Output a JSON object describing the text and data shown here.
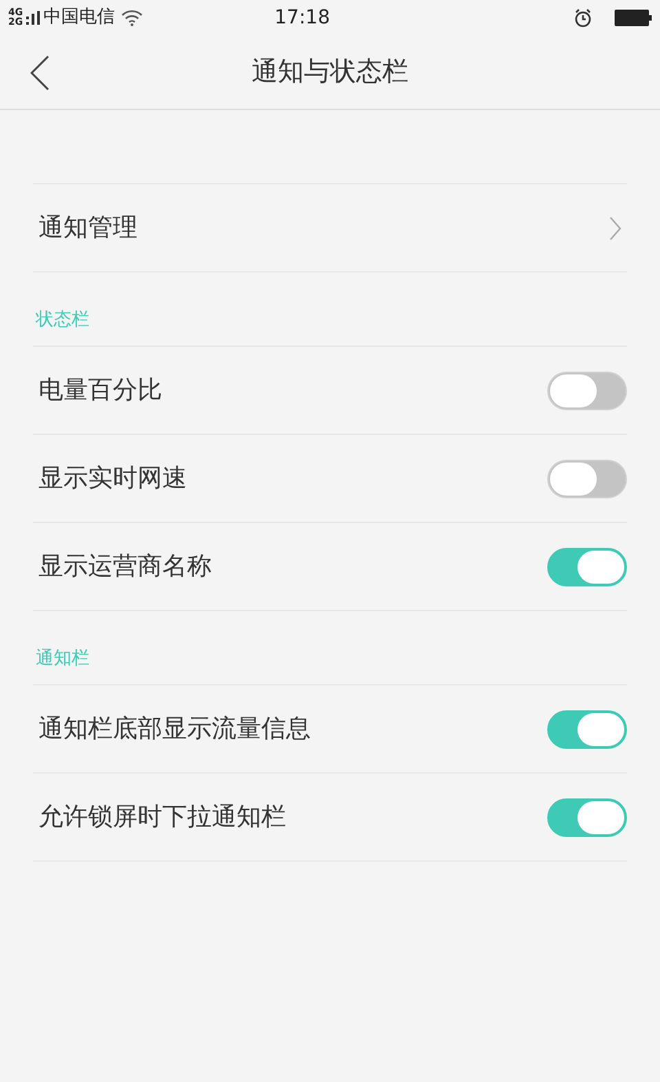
{
  "status_bar": {
    "network_top": "4G",
    "network_bottom": "2G",
    "carrier": "中国电信",
    "time": "17:18"
  },
  "header": {
    "title": "通知与状态栏"
  },
  "links": [
    {
      "label": "通知管理"
    }
  ],
  "sections": [
    {
      "title": "状态栏",
      "items": [
        {
          "label": "电量百分比",
          "on": false
        },
        {
          "label": "显示实时网速",
          "on": false
        },
        {
          "label": "显示运营商名称",
          "on": true
        }
      ]
    },
    {
      "title": "通知栏",
      "items": [
        {
          "label": "通知栏底部显示流量信息",
          "on": true
        },
        {
          "label": "允许锁屏时下拉通知栏",
          "on": true
        }
      ]
    }
  ]
}
